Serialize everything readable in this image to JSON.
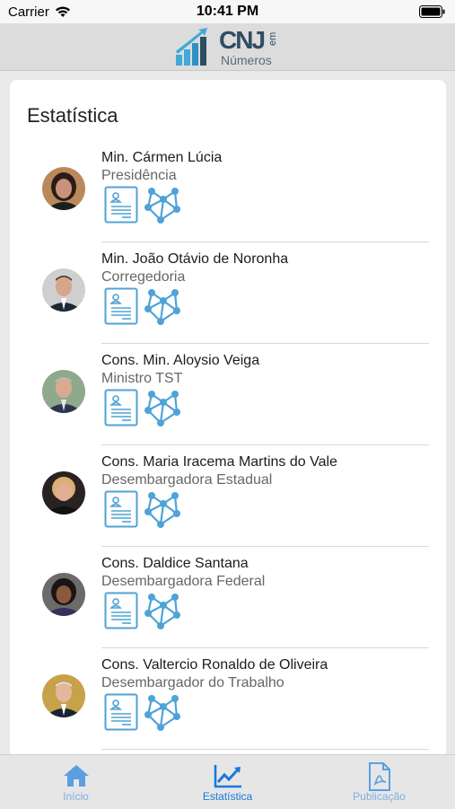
{
  "status_bar": {
    "carrier": "Carrier",
    "time": "10:41 PM"
  },
  "header": {
    "logo_word": "CNJ",
    "logo_em": "em",
    "logo_sub": "Números"
  },
  "page": {
    "title": "Estatística"
  },
  "members": [
    {
      "name": "Min. Cármen Lúcia",
      "role": "Presidência"
    },
    {
      "name": "Min. João Otávio de Noronha",
      "role": "Corregedoria"
    },
    {
      "name": "Cons. Min. Aloysio Veiga",
      "role": "Ministro TST"
    },
    {
      "name": "Cons. Maria Iracema Martins do Vale",
      "role": "Desembargadora Estadual"
    },
    {
      "name": "Cons. Daldice Santana",
      "role": "Desembargadora Federal"
    },
    {
      "name": "Cons. Valtercio Ronaldo de Oliveira",
      "role": "Desembargador do Trabalho"
    }
  ],
  "tabs": [
    {
      "label": "Início",
      "icon": "home-icon",
      "active": false
    },
    {
      "label": "Estatística",
      "icon": "chart-icon",
      "active": true
    },
    {
      "label": "Publicação",
      "icon": "pdf-icon",
      "active": false
    }
  ],
  "colors": {
    "accent": "#1a78d8",
    "icon_blue": "#4fa3d6",
    "tab_inactive": "#7fb0e0"
  }
}
